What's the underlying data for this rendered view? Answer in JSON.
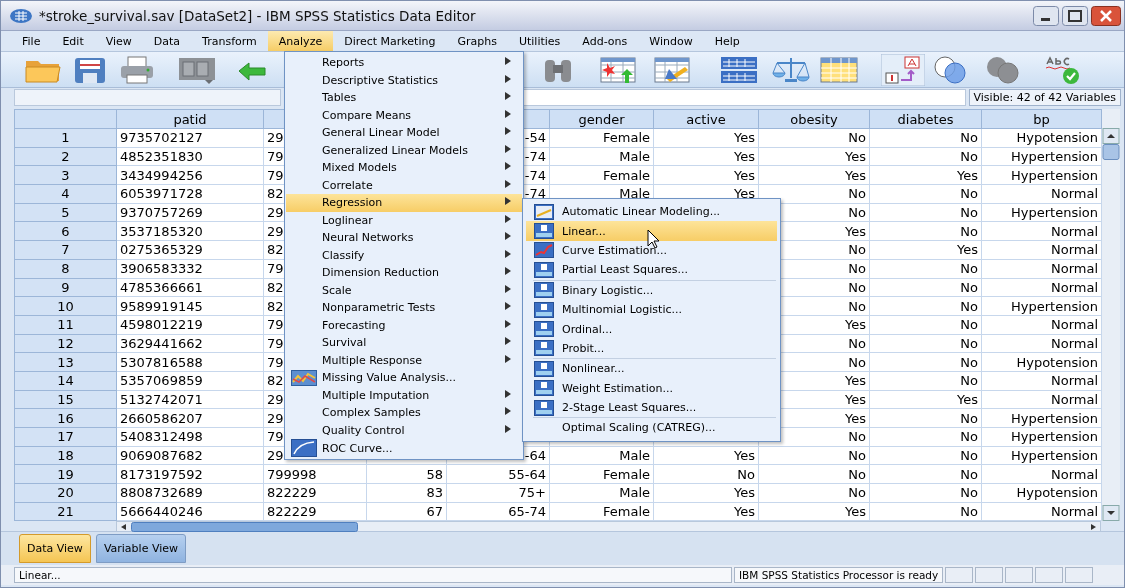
{
  "window": {
    "title": "*stroke_survival.sav [DataSet2] - IBM SPSS Statistics Data Editor"
  },
  "menubar": {
    "items": [
      {
        "label": "File",
        "selected": false
      },
      {
        "label": "Edit",
        "selected": false
      },
      {
        "label": "View",
        "selected": false
      },
      {
        "label": "Data",
        "selected": false
      },
      {
        "label": "Transform",
        "selected": false
      },
      {
        "label": "Analyze",
        "selected": true
      },
      {
        "label": "Direct Marketing",
        "selected": false
      },
      {
        "label": "Graphs",
        "selected": false
      },
      {
        "label": "Utilities",
        "selected": false
      },
      {
        "label": "Add-ons",
        "selected": false
      },
      {
        "label": "Window",
        "selected": false
      },
      {
        "label": "Help",
        "selected": false
      }
    ]
  },
  "editor_bar": {
    "visible_variables": "Visible: 42 of 42 Variables"
  },
  "table": {
    "columns": [
      "patid",
      null,
      null,
      null,
      "gender",
      "active",
      "obesity",
      "diabetes",
      "bp"
    ],
    "rows": [
      {
        "number": "1",
        "cells": [
          "9735702127",
          "29",
          null,
          "-54",
          "Female",
          "Yes",
          "No",
          "No",
          "Hypotension"
        ]
      },
      {
        "number": "2",
        "cells": [
          "4852351830",
          "79",
          null,
          "-74",
          "Male",
          "Yes",
          "Yes",
          "No",
          "Hypertension"
        ]
      },
      {
        "number": "3",
        "cells": [
          "3434994256",
          "79",
          null,
          "-74",
          "Female",
          "Yes",
          "Yes",
          "Yes",
          "Hypertension"
        ]
      },
      {
        "number": "4",
        "cells": [
          "6053971728",
          "82",
          null,
          "-74",
          "Male",
          "Yes",
          "No",
          "No",
          "Normal"
        ]
      },
      {
        "number": "5",
        "cells": [
          "9370757269",
          "29",
          null,
          null,
          null,
          null,
          "No",
          "No",
          "Hypertension"
        ]
      },
      {
        "number": "6",
        "cells": [
          "3537185320",
          "29",
          null,
          null,
          null,
          null,
          "Yes",
          "No",
          "Normal"
        ]
      },
      {
        "number": "7",
        "cells": [
          "0275365329",
          "82",
          null,
          null,
          null,
          null,
          "No",
          "Yes",
          "Normal"
        ]
      },
      {
        "number": "8",
        "cells": [
          "3906583332",
          "79",
          null,
          null,
          null,
          null,
          "No",
          "No",
          "Normal"
        ]
      },
      {
        "number": "9",
        "cells": [
          "4785366661",
          "82",
          null,
          null,
          null,
          null,
          "No",
          "No",
          "Normal"
        ]
      },
      {
        "number": "10",
        "cells": [
          "9589919145",
          "82",
          null,
          null,
          null,
          null,
          "No",
          "No",
          "Hypertension"
        ]
      },
      {
        "number": "11",
        "cells": [
          "4598012219",
          "79",
          null,
          null,
          null,
          null,
          "Yes",
          "No",
          "Normal"
        ]
      },
      {
        "number": "12",
        "cells": [
          "3629441662",
          "79",
          null,
          null,
          null,
          null,
          "No",
          "No",
          "Normal"
        ]
      },
      {
        "number": "13",
        "cells": [
          "5307816588",
          "79",
          null,
          null,
          null,
          null,
          "No",
          "No",
          "Hypotension"
        ]
      },
      {
        "number": "14",
        "cells": [
          "5357069859",
          "82",
          null,
          null,
          null,
          null,
          "Yes",
          "No",
          "Normal"
        ]
      },
      {
        "number": "15",
        "cells": [
          "5132742071",
          "29",
          null,
          null,
          null,
          null,
          "Yes",
          "Yes",
          "Normal"
        ]
      },
      {
        "number": "16",
        "cells": [
          "2660586207",
          "29",
          null,
          null,
          null,
          null,
          "Yes",
          "No",
          "Hypertension"
        ]
      },
      {
        "number": "17",
        "cells": [
          "5408312498",
          "79",
          null,
          null,
          null,
          null,
          "No",
          "No",
          "Hypertension"
        ]
      },
      {
        "number": "18",
        "cells": [
          "9069087682",
          "29",
          null,
          "-64",
          "Male",
          "Yes",
          "No",
          "No",
          "Hypertension"
        ]
      },
      {
        "number": "19",
        "cells": [
          "8173197592",
          "799998",
          "58",
          "55-64",
          "Female",
          "No",
          "No",
          "No",
          "Normal"
        ]
      },
      {
        "number": "20",
        "cells": [
          "8808732689",
          "822229",
          "83",
          "75+",
          "Male",
          "Yes",
          "No",
          "No",
          "Hypotension"
        ]
      },
      {
        "number": "21",
        "cells": [
          "5666440246",
          "822229",
          "67",
          "65-74",
          "Female",
          "Yes",
          "Yes",
          "No",
          "Normal"
        ]
      }
    ]
  },
  "analyze_menu": {
    "items": [
      {
        "label": "Reports",
        "kind": "submenu",
        "selected": false
      },
      {
        "label": "Descriptive Statistics",
        "kind": "submenu",
        "selected": false
      },
      {
        "label": "Tables",
        "kind": "submenu",
        "selected": false
      },
      {
        "label": "Compare Means",
        "kind": "submenu",
        "selected": false
      },
      {
        "label": "General Linear Model",
        "kind": "submenu",
        "selected": false
      },
      {
        "label": "Generalized Linear Models",
        "kind": "submenu",
        "selected": false
      },
      {
        "label": "Mixed Models",
        "kind": "submenu",
        "selected": false
      },
      {
        "label": "Correlate",
        "kind": "submenu",
        "selected": false
      },
      {
        "label": "Regression",
        "kind": "submenu",
        "selected": true
      },
      {
        "label": "Loglinear",
        "kind": "submenu",
        "selected": false
      },
      {
        "label": "Neural Networks",
        "kind": "submenu",
        "selected": false
      },
      {
        "label": "Classify",
        "kind": "submenu",
        "selected": false
      },
      {
        "label": "Dimension Reduction",
        "kind": "submenu",
        "selected": false
      },
      {
        "label": "Scale",
        "kind": "submenu",
        "selected": false
      },
      {
        "label": "Nonparametric Tests",
        "kind": "submenu",
        "selected": false
      },
      {
        "label": "Forecasting",
        "kind": "submenu",
        "selected": false
      },
      {
        "label": "Survival",
        "kind": "submenu",
        "selected": false
      },
      {
        "label": "Multiple Response",
        "kind": "submenu",
        "selected": false
      },
      {
        "label": "Missing Value Analysis...",
        "kind": "chart",
        "selected": false
      },
      {
        "label": "Multiple Imputation",
        "kind": "submenu",
        "selected": false
      },
      {
        "label": "Complex Samples",
        "kind": "submenu",
        "selected": false
      },
      {
        "label": "Quality Control",
        "kind": "submenu",
        "selected": false
      },
      {
        "label": "ROC Curve...",
        "kind": "curve",
        "selected": false
      }
    ]
  },
  "regression_menu": {
    "groups": [
      [
        {
          "label": "Automatic Linear Modeling...",
          "kind": "plot",
          "selected": false
        },
        {
          "label": "Linear...",
          "kind": "procedure",
          "selected": true
        },
        {
          "label": "Curve Estimation...",
          "kind": "curve",
          "selected": false
        },
        {
          "label": "Partial Least Squares...",
          "kind": "procedure",
          "selected": false
        }
      ],
      [
        {
          "label": "Binary Logistic...",
          "kind": "procedure",
          "selected": false
        },
        {
          "label": "Multinomial Logistic...",
          "kind": "procedure",
          "selected": false
        },
        {
          "label": "Ordinal...",
          "kind": "procedure",
          "selected": false
        },
        {
          "label": "Probit...",
          "kind": "procedure",
          "selected": false
        }
      ],
      [
        {
          "label": "Nonlinear...",
          "kind": "procedure",
          "selected": false
        },
        {
          "label": "Weight Estimation...",
          "kind": "procedure",
          "selected": false
        },
        {
          "label": "2-Stage Least Squares...",
          "kind": "procedure",
          "selected": false
        }
      ],
      [
        {
          "label": "Optimal Scaling (CATREG)...",
          "kind": "plain",
          "selected": false
        }
      ]
    ]
  },
  "view_tabs": [
    {
      "label": "Data View",
      "selected": true
    },
    {
      "label": "Variable View",
      "selected": false
    }
  ],
  "status_bar": {
    "message": "Linear...",
    "processor_status": "IBM SPSS Statistics Processor is ready"
  }
}
